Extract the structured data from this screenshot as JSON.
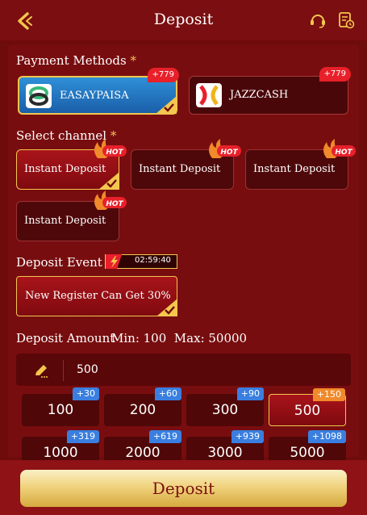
{
  "header": {
    "title": "Deposit"
  },
  "payment": {
    "label": "Payment Methods",
    "required_mark": "*",
    "methods": [
      {
        "name": "EASAYPAISA",
        "bonus": "+779",
        "selected": true
      },
      {
        "name": "JAZZCASH",
        "bonus": "+779",
        "selected": false
      }
    ]
  },
  "channel": {
    "label": "Select channel",
    "required_mark": "*",
    "items": [
      {
        "label": "Instant Deposit",
        "badge": "HOT",
        "selected": true
      },
      {
        "label": "Instant Deposit",
        "badge": "HOT",
        "selected": false
      },
      {
        "label": "Instant Deposit",
        "badge": "HOT",
        "selected": false
      },
      {
        "label": "Instant Deposit",
        "badge": "HOT",
        "selected": false
      }
    ]
  },
  "event": {
    "label": "Deposit Event",
    "required_mark": "*",
    "timer": "02:59:40",
    "offer": "New Register Can Get 30%"
  },
  "amount": {
    "label": "Deposit Amount",
    "min_max": "Min: 100  Max: 50000",
    "value": "500",
    "options": [
      {
        "value": "100",
        "bonus": "+30"
      },
      {
        "value": "200",
        "bonus": "+60"
      },
      {
        "value": "300",
        "bonus": "+90"
      },
      {
        "value": "500",
        "bonus": "+150",
        "selected": true
      },
      {
        "value": "1000",
        "bonus": "+319"
      },
      {
        "value": "2000",
        "bonus": "+619"
      },
      {
        "value": "3000",
        "bonus": "+939"
      },
      {
        "value": "5000",
        "bonus": "+1098"
      }
    ]
  },
  "footer": {
    "deposit_label": "Deposit"
  },
  "colors": {
    "accent_gold": "#f4c64e",
    "background": "#6e0b0b",
    "badge_red": "#e8202a",
    "bonus_blue": "#3a7fe0"
  }
}
